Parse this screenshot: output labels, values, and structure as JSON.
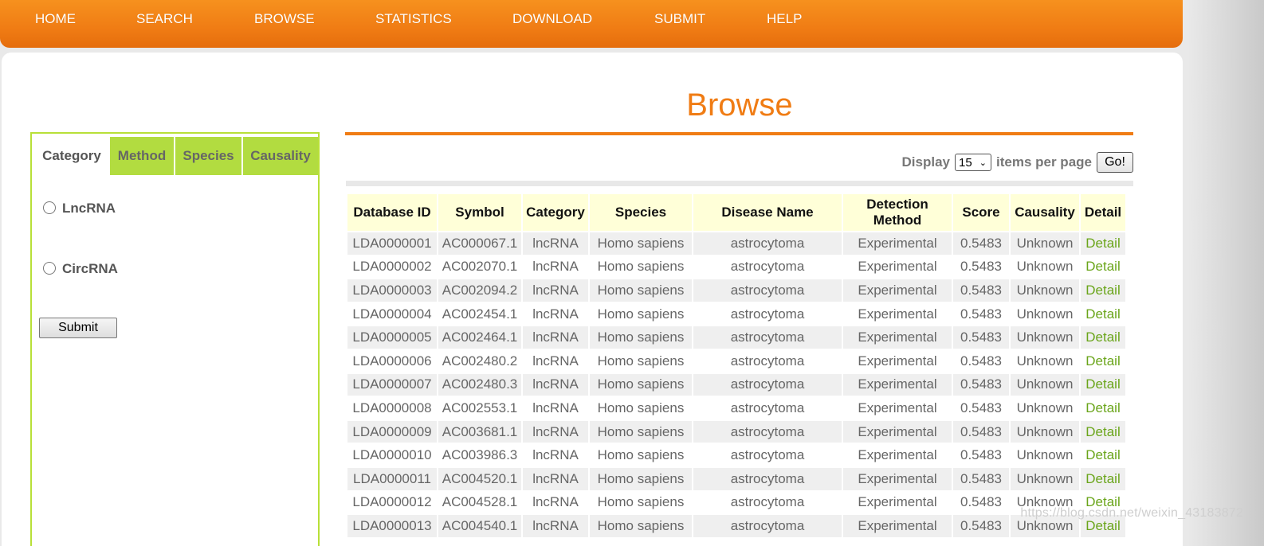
{
  "nav": [
    "HOME",
    "SEARCH",
    "BROWSE",
    "STATISTICS",
    "DOWNLOAD",
    "SUBMIT",
    "HELP"
  ],
  "page_title": "Browse",
  "sidebar": {
    "tabs": [
      "Category",
      "Method",
      "Species",
      "Causality"
    ],
    "options": [
      "LncRNA",
      "CircRNA"
    ],
    "submit_label": "Submit"
  },
  "pager": {
    "display_label": "Display",
    "value": "15",
    "items_label": "items per page",
    "go_label": "Go!"
  },
  "table": {
    "headers": [
      "Database ID",
      "Symbol",
      "Category",
      "Species",
      "Disease Name",
      "Detection Method",
      "Score",
      "Causality",
      "Detail"
    ],
    "rows": [
      [
        "LDA0000001",
        "AC000067.1",
        "lncRNA",
        "Homo sapiens",
        "astrocytoma",
        "Experimental",
        "0.5483",
        "Unknown",
        "Detail"
      ],
      [
        "LDA0000002",
        "AC002070.1",
        "lncRNA",
        "Homo sapiens",
        "astrocytoma",
        "Experimental",
        "0.5483",
        "Unknown",
        "Detail"
      ],
      [
        "LDA0000003",
        "AC002094.2",
        "lncRNA",
        "Homo sapiens",
        "astrocytoma",
        "Experimental",
        "0.5483",
        "Unknown",
        "Detail"
      ],
      [
        "LDA0000004",
        "AC002454.1",
        "lncRNA",
        "Homo sapiens",
        "astrocytoma",
        "Experimental",
        "0.5483",
        "Unknown",
        "Detail"
      ],
      [
        "LDA0000005",
        "AC002464.1",
        "lncRNA",
        "Homo sapiens",
        "astrocytoma",
        "Experimental",
        "0.5483",
        "Unknown",
        "Detail"
      ],
      [
        "LDA0000006",
        "AC002480.2",
        "lncRNA",
        "Homo sapiens",
        "astrocytoma",
        "Experimental",
        "0.5483",
        "Unknown",
        "Detail"
      ],
      [
        "LDA0000007",
        "AC002480.3",
        "lncRNA",
        "Homo sapiens",
        "astrocytoma",
        "Experimental",
        "0.5483",
        "Unknown",
        "Detail"
      ],
      [
        "LDA0000008",
        "AC002553.1",
        "lncRNA",
        "Homo sapiens",
        "astrocytoma",
        "Experimental",
        "0.5483",
        "Unknown",
        "Detail"
      ],
      [
        "LDA0000009",
        "AC003681.1",
        "lncRNA",
        "Homo sapiens",
        "astrocytoma",
        "Experimental",
        "0.5483",
        "Unknown",
        "Detail"
      ],
      [
        "LDA0000010",
        "AC003986.3",
        "lncRNA",
        "Homo sapiens",
        "astrocytoma",
        "Experimental",
        "0.5483",
        "Unknown",
        "Detail"
      ],
      [
        "LDA0000011",
        "AC004520.1",
        "lncRNA",
        "Homo sapiens",
        "astrocytoma",
        "Experimental",
        "0.5483",
        "Unknown",
        "Detail"
      ],
      [
        "LDA0000012",
        "AC004528.1",
        "lncRNA",
        "Homo sapiens",
        "astrocytoma",
        "Experimental",
        "0.5483",
        "Unknown",
        "Detail"
      ],
      [
        "LDA0000013",
        "AC004540.1",
        "lncRNA",
        "Homo sapiens",
        "astrocytoma",
        "Experimental",
        "0.5483",
        "Unknown",
        "Detail"
      ]
    ]
  },
  "watermark": "https://blog.csdn.net/weixin_43183872",
  "colors": {
    "accent": "#f07c14",
    "tab_green": "#b2dc40",
    "link_green": "#6aa51a",
    "header_bg": "#ffffd8"
  }
}
